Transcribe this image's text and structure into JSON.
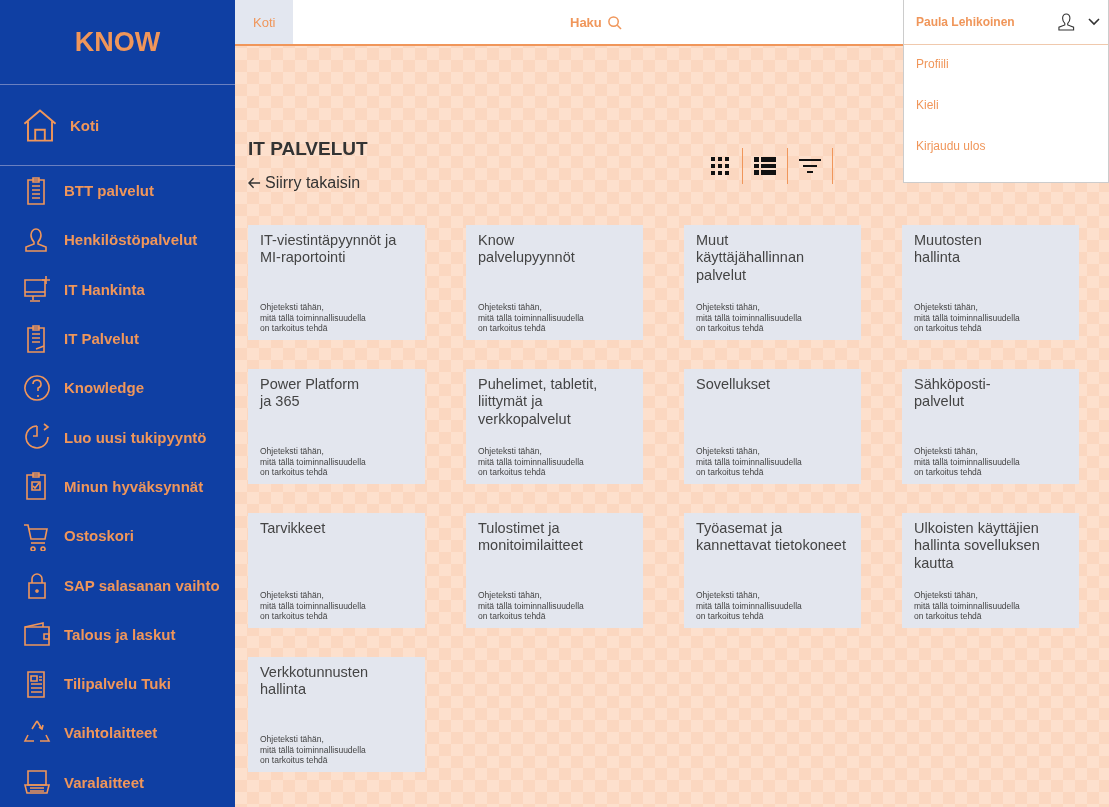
{
  "sidebar": {
    "logo": "KNOW",
    "home": "Koti",
    "items": [
      {
        "label": "BTT palvelut"
      },
      {
        "label": "Henkilöstöpalvelut"
      },
      {
        "label": "IT Hankinta"
      },
      {
        "label": "IT Palvelut"
      },
      {
        "label": "Knowledge"
      },
      {
        "label": "Luo uusi tukipyyntö"
      },
      {
        "label": "Minun hyväksynnät"
      },
      {
        "label": "Ostoskori"
      },
      {
        "label": "SAP salasanan vaihto"
      },
      {
        "label": "Talous ja laskut"
      },
      {
        "label": "Tilipalvelu Tuki"
      },
      {
        "label": "Vaihtolaitteet"
      },
      {
        "label": "Varalaitteet"
      }
    ]
  },
  "topbar": {
    "home_tab": "Koti",
    "search": "Haku",
    "user": "Paula Lehikoinen"
  },
  "user_menu": [
    "Profiili",
    "Kieli",
    "Kirjaudu ulos"
  ],
  "page": {
    "title": "IT PALVELUT",
    "back": "Siirry takaisin"
  },
  "cards": [
    {
      "title": "IT-viestintäpyynnöt ja\nMI-raportointi",
      "text": "Ohjeteksti tähän,\nmitä tällä toiminnallisuudella\non tarkoitus tehdä"
    },
    {
      "title": "Know\npalvelupyynnöt",
      "text": "Ohjeteksti tähän,\nmitä tällä toiminnallisuudella\non tarkoitus tehdä"
    },
    {
      "title": "Muut\nkäyttäjähallinnan\npalvelut",
      "text": "Ohjeteksti tähän,\nmitä tällä toiminnallisuudella\non tarkoitus tehdä"
    },
    {
      "title": "Muutosten\nhallinta",
      "text": "Ohjeteksti tähän,\nmitä tällä toiminnallisuudella\non tarkoitus tehdä"
    },
    {
      "title": "Power Platform\nja 365",
      "text": "Ohjeteksti tähän,\nmitä tällä toiminnallisuudella\non tarkoitus tehdä"
    },
    {
      "title": "Puhelimet, tabletit,\nliittymät ja\nverkkopalvelut",
      "text": "Ohjeteksti tähän,\nmitä tällä toiminnallisuudella\non tarkoitus tehdä"
    },
    {
      "title": "Sovellukset",
      "text": "Ohjeteksti tähän,\nmitä tällä toiminnallisuudella\non tarkoitus tehdä"
    },
    {
      "title": "Sähköposti-\npalvelut",
      "text": "Ohjeteksti tähän,\nmitä tällä toiminnallisuudella\non tarkoitus tehdä"
    },
    {
      "title": "Tarvikkeet",
      "text": "Ohjeteksti tähän,\nmitä tällä toiminnallisuudella\non tarkoitus tehdä"
    },
    {
      "title": "Tulostimet ja\nmonitoimilaitteet",
      "text": "Ohjeteksti tähän,\nmitä tällä toiminnallisuudella\non tarkoitus tehdä"
    },
    {
      "title": "Työasemat ja\nkannettavat tietokoneet",
      "text": "Ohjeteksti tähän,\nmitä tällä toiminnallisuudella\non tarkoitus tehdä"
    },
    {
      "title": "Ulkoisten käyttäjien\nhallinta sovelluksen\nkautta",
      "text": "Ohjeteksti tähän,\nmitä tällä toiminnallisuudella\non tarkoitus tehdä"
    },
    {
      "title": "Verkkotunnusten\nhallinta",
      "text": "Ohjeteksti tähän,\nmitä tällä toiminnallisuudella\non tarkoitus tehdä"
    }
  ]
}
